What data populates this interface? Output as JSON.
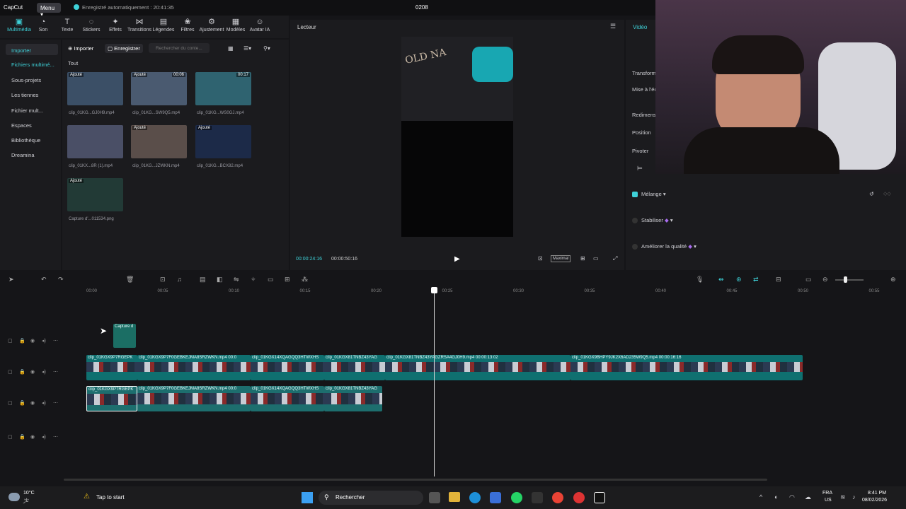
{
  "app": {
    "logo": "CapCut",
    "menu": "Menu",
    "autosave": "Enregistré automatiquement : 20:41:35",
    "project": "0208"
  },
  "toolbar": [
    {
      "icon": "media-icon",
      "label": "Multimédia"
    },
    {
      "icon": "audio-icon",
      "label": "Son"
    },
    {
      "icon": "text-icon",
      "label": "Texte"
    },
    {
      "icon": "sticker-icon",
      "label": "Stickers"
    },
    {
      "icon": "effects-icon",
      "label": "Effets"
    },
    {
      "icon": "transition-icon",
      "label": "Transitions"
    },
    {
      "icon": "caption-icon",
      "label": "Légendes"
    },
    {
      "icon": "filter-icon",
      "label": "Filtres"
    },
    {
      "icon": "adjust-icon",
      "label": "Ajustement"
    },
    {
      "icon": "template-icon",
      "label": "Modèles"
    },
    {
      "icon": "avatar-icon",
      "label": "Avatar IA"
    }
  ],
  "leftnav": [
    "Importer",
    "Fichiers multimé...",
    "Sous-projets",
    "Les tiennes",
    "Fichier mult...",
    "Espaces",
    "Bibliothèque",
    "Dreamina"
  ],
  "media": {
    "import": "Importer",
    "record": "Enregistrer",
    "search_placeholder": "Rechercher du conte...",
    "all": "Tout",
    "items": [
      {
        "name": "clip_01KG...GJ0H9.mp4",
        "badge": "Ajouté"
      },
      {
        "name": "clip_01KG...SW9Q5.mp4",
        "badge": "Ajouté",
        "duration": "00:06"
      },
      {
        "name": "clip_01KG...WS0GJ.mp4",
        "badge": "",
        "duration": "00:17"
      },
      {
        "name": "clip_01KX...8R (1).mp4",
        "badge": ""
      },
      {
        "name": "clip_01KG...JZWKN.mp4",
        "badge": "Ajouté"
      },
      {
        "name": "clip_01KG...BCX82.mp4",
        "badge": "Ajouté"
      },
      {
        "name": "Capture d'...011534.png",
        "badge": "Ajouté"
      }
    ]
  },
  "player": {
    "title": "Lecteur",
    "overlay_text": "OLD NA",
    "current": "00:00:24:16",
    "total": "00:00:50:16",
    "ratio": "Maximal"
  },
  "props": {
    "tab": "Vidéo",
    "labels": [
      "Transform",
      "Mise à l'éc",
      "Redimens",
      "Position",
      "Pivoter"
    ],
    "blend": "Mélange",
    "stabilize": "Stabiliser",
    "enhance": "Améliorer la qualité"
  },
  "ruler": [
    "00:00",
    "00:05",
    "00:10",
    "00:15",
    "00:20",
    "00:25",
    "00:30",
    "00:35",
    "00:40",
    "00:45",
    "00:50",
    "00:55"
  ],
  "clips": {
    "capture": "Capture d",
    "t1": [
      "clip_01KGX9P7RGEPK",
      "clip_01KGX9P7F0GEBKEJMA8SRZWKN.mp4  00:0",
      "clip_01KGX14XQAGQQ3HTWXHS",
      "clip_01KGX81TNBZ43YAG",
      "clip_01KGX81TNBZ43YAGZRSA4GJ0H9.mp4  00:00:13:02",
      "clip_01KGX9BHPY9JK2X6AD235W9Q5.mp4  00:00:16:16"
    ],
    "t2": [
      "clip_01KGX9P7RGEPK",
      "clip_01KGX9P7F0GEBKEJMA8SRZWKN.mp4  00:0",
      "clip_01KGX14XQAGQQ3HTWXHS",
      "clip_01KGX81TNBZ43YAG"
    ]
  },
  "taskbar": {
    "temp": "10°C",
    "loc": "ٹاڑ",
    "tap": "Tap to start",
    "search": "Rechercher",
    "lang1": "FRA",
    "lang2": "US",
    "time": "8:41 PM",
    "date": "08/02/2026"
  }
}
